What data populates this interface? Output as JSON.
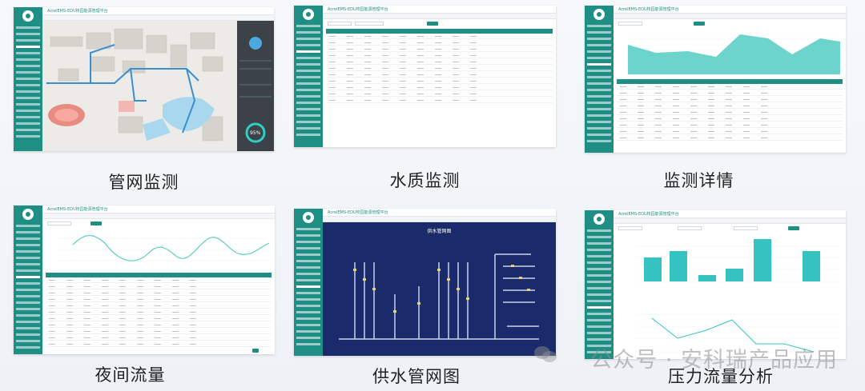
{
  "app_title": "AcrelEMS-EDU校园能源管理平台",
  "captions": [
    "管网监测",
    "水质监测",
    "监测详情",
    "夜间流量",
    "供水管网图",
    "压力流量分析"
  ],
  "diagram_title": "供水管网图",
  "water_gauge": "95%",
  "watermark": "公众号 · 安科瑞产品应用",
  "colors": {
    "teal": "#1f8f86",
    "chart_fill": "#5ccfc6",
    "bar": "#34c3c1",
    "map_water": "#a9d8ee",
    "diagram_bg": "#1b2a6b"
  }
}
